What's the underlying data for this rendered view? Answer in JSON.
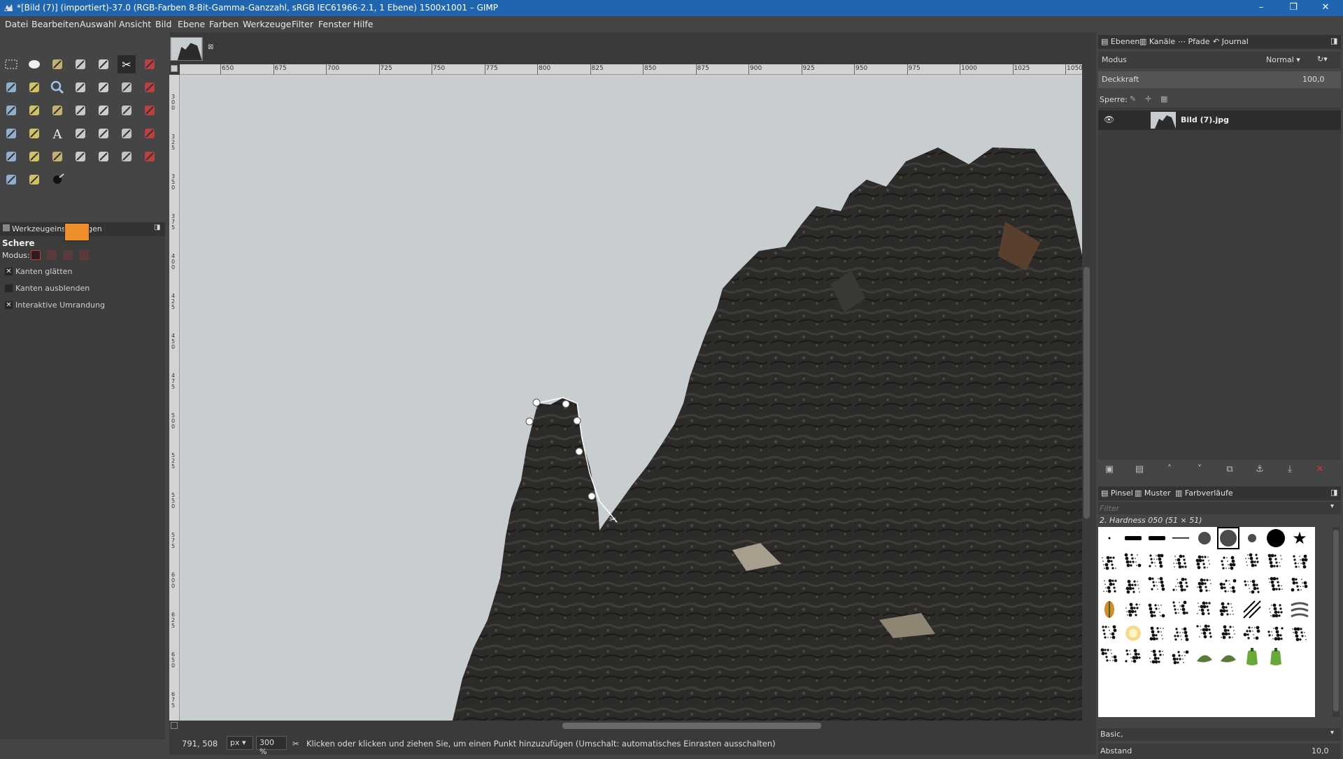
{
  "window": {
    "title": "*[Bild (7)] (importiert)-37.0 (RGB-Farben 8-Bit-Gamma-Ganzzahl, sRGB IEC61966-2.1, 1 Ebene) 1500x1001 – GIMP",
    "minimize": "–",
    "maximize": "❐",
    "close": "✕"
  },
  "menu": [
    "Datei",
    "Bearbeiten",
    "Auswahl",
    "Ansicht",
    "Bild",
    "Ebene",
    "Farben",
    "Werkzeuge",
    "Filter",
    "Fenster",
    "Hilfe"
  ],
  "colors": {
    "foreground": "#ef8f2c",
    "background": "#c8161b",
    "titlebar": "#1f65b0"
  },
  "tools": [
    "rect-select-icon",
    "ellipse-select-icon",
    "free-select-icon",
    "fuzzy-select-icon",
    "select-by-color-icon",
    "scissors-select-icon",
    "foreground-select-icon",
    "move-icon",
    "eyedropper-icon",
    "zoom-icon",
    "measure-icon",
    "crosshair-move-icon",
    "align-icon",
    "crop-icon",
    "unified-transform-icon",
    "rotate-icon",
    "scale-icon",
    "shear-icon",
    "perspective-icon",
    "flip-icon",
    "cage-icon",
    "warp-icon",
    "paths-icon",
    "text-icon",
    "bucket-fill-icon",
    "gradient-icon",
    "pencil-icon",
    "paintbrush-icon",
    "eraser-icon",
    "airbrush-icon",
    "ink-icon",
    "mypaint-icon",
    "clone-icon",
    "heal-icon",
    "smudge-icon",
    "blur-icon",
    "dodge-icon",
    "color-dot-icon"
  ],
  "tool_options": {
    "tab_label": "Werkzeugeinstellungen",
    "tool_name": "Schere",
    "mode_label": "Modus:",
    "options": [
      {
        "label": "Kanten glätten",
        "checked": true
      },
      {
        "label": "Kanten ausblenden",
        "checked": false
      },
      {
        "label": "Interaktive Umrandung",
        "checked": true
      }
    ]
  },
  "ruler": {
    "top_ticks": [
      "650",
      "675",
      "700",
      "725",
      "750",
      "775",
      "800",
      "825",
      "850",
      "875",
      "900",
      "925",
      "950",
      "975",
      "1000",
      "1025",
      "1050"
    ],
    "left_ticks": [
      "300",
      "325",
      "350",
      "375",
      "400",
      "425",
      "450",
      "475",
      "500",
      "525",
      "550",
      "575",
      "600",
      "625",
      "650",
      "675"
    ]
  },
  "statusbar": {
    "coords": "791, 508",
    "unit": "px",
    "zoom": "300 %",
    "message": "Klicken oder klicken und ziehen Sie, um einen Punkt hinzuzufügen (Umschalt: automatisches Einrasten ausschalten)"
  },
  "layers_dock": {
    "tabs": [
      "Ebenen",
      "Kanäle",
      "Pfade",
      "Journal"
    ],
    "mode_label": "Modus",
    "mode_value": "Normal",
    "opacity_label": "Deckkraft",
    "opacity_value": "100,0",
    "lock_label": "Sperre:",
    "layers": [
      {
        "name": "Bild (7).jpg",
        "visible": true
      }
    ]
  },
  "brushes_dock": {
    "tabs": [
      "Pinsel",
      "Muster",
      "Farbverläufe"
    ],
    "filter_placeholder": "Filter",
    "selected_brush": "2. Hardness 050 (51 × 51)",
    "preset": "Basic,",
    "spacing_label": "Abstand",
    "spacing_value": "10,0"
  }
}
